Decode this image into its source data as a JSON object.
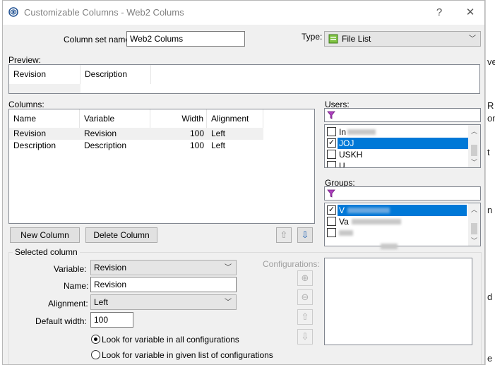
{
  "window": {
    "title": "Customizable Columns - Web2 Colums",
    "help_glyph": "?",
    "close_glyph": "✕"
  },
  "column_set": {
    "label": "Column set name:",
    "value": "Web2 Colums"
  },
  "type": {
    "label": "Type:",
    "value": "File List"
  },
  "preview": {
    "label": "Preview:",
    "headers": [
      "Revision",
      "Description"
    ]
  },
  "columns": {
    "label": "Columns:",
    "headers": {
      "name": "Name",
      "variable": "Variable",
      "width": "Width",
      "alignment": "Alignment"
    },
    "rows": [
      {
        "name": "Revision",
        "variable": "Revision",
        "width": "100",
        "alignment": "Left"
      },
      {
        "name": "Description",
        "variable": "Description",
        "width": "100",
        "alignment": "Left"
      }
    ]
  },
  "buttons": {
    "new_column": "New Column",
    "delete_column": "Delete Column"
  },
  "users": {
    "label": "Users:",
    "items": [
      {
        "label": "In",
        "checked": false,
        "selected": false
      },
      {
        "label": "JOJ",
        "checked": true,
        "selected": true
      },
      {
        "label": "USKH",
        "checked": false,
        "selected": false
      },
      {
        "label": "U",
        "checked": false,
        "selected": false
      }
    ]
  },
  "groups": {
    "label": "Groups:",
    "items": [
      {
        "label": "V",
        "checked": true,
        "selected": true
      },
      {
        "label": "Va",
        "checked": false,
        "selected": false
      },
      {
        "label": "",
        "checked": false,
        "selected": false
      }
    ]
  },
  "selected_column": {
    "label": "Selected column",
    "variable": {
      "label": "Variable:",
      "value": "Revision"
    },
    "name": {
      "label": "Name:",
      "value": "Revision"
    },
    "alignment": {
      "label": "Alignment:",
      "value": "Left"
    },
    "default_width": {
      "label": "Default width:",
      "value": "100"
    },
    "configurations_label": "Configurations:",
    "radio_all": "Look for variable in all configurations",
    "radio_list": "Look for variable in given list of configurations"
  },
  "colors": {
    "selection": "#0078d7",
    "filter_icon": "#b040c0",
    "arrow_blue": "#1a5fb4"
  }
}
